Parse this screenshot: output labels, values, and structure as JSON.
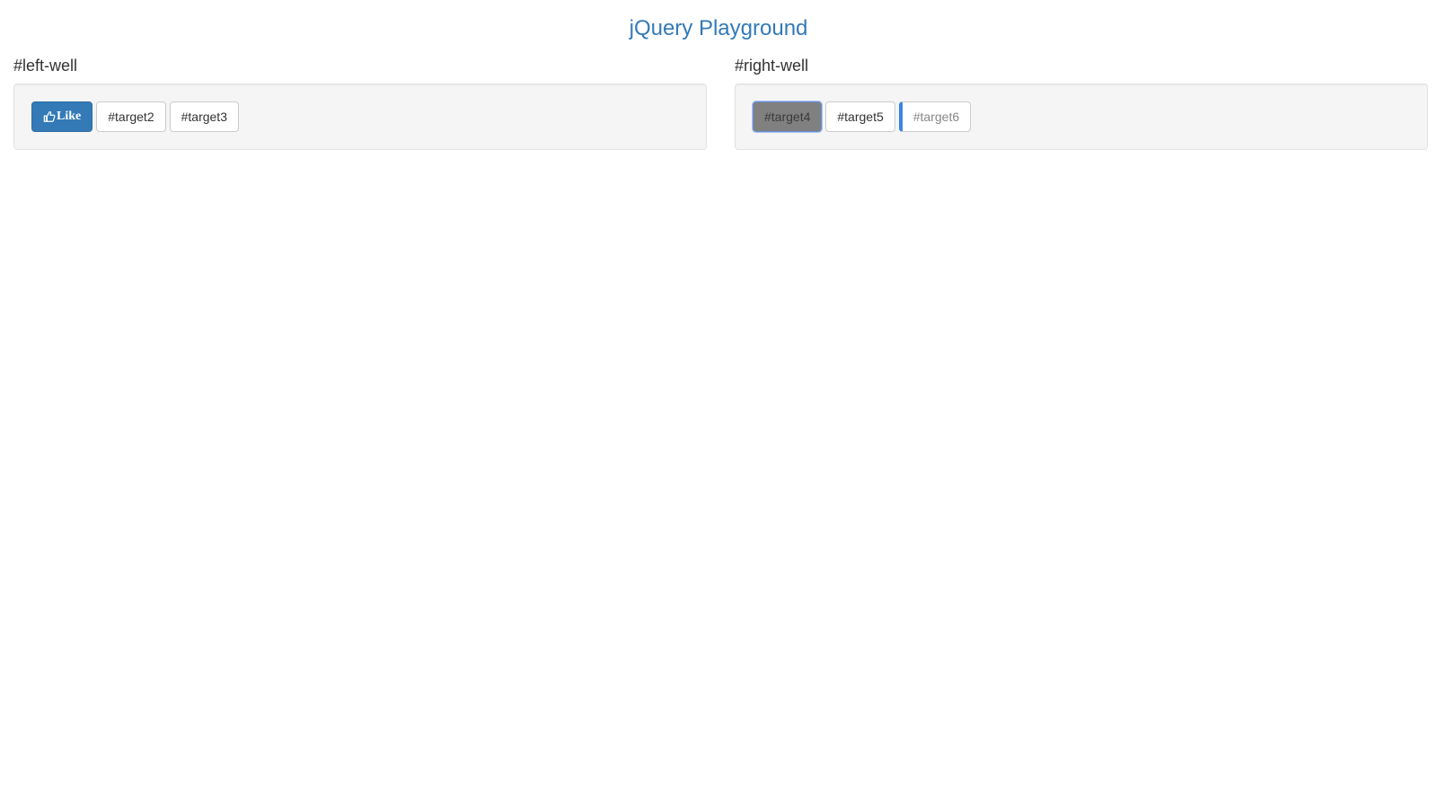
{
  "title": "jQuery Playground",
  "left_well": {
    "heading": "#left-well",
    "buttons": [
      {
        "label": "Like",
        "icon": "thumbs-up-icon"
      },
      {
        "label": "#target2"
      },
      {
        "label": "#target3"
      }
    ]
  },
  "right_well": {
    "heading": "#right-well",
    "buttons": [
      {
        "label": "#target4"
      },
      {
        "label": "#target5"
      },
      {
        "label": "#target6"
      }
    ]
  },
  "colors": {
    "title": "#337ab7",
    "primary_button": "#337ab7",
    "active_button_bg": "#808080",
    "accent_border": "#3a86e0"
  }
}
